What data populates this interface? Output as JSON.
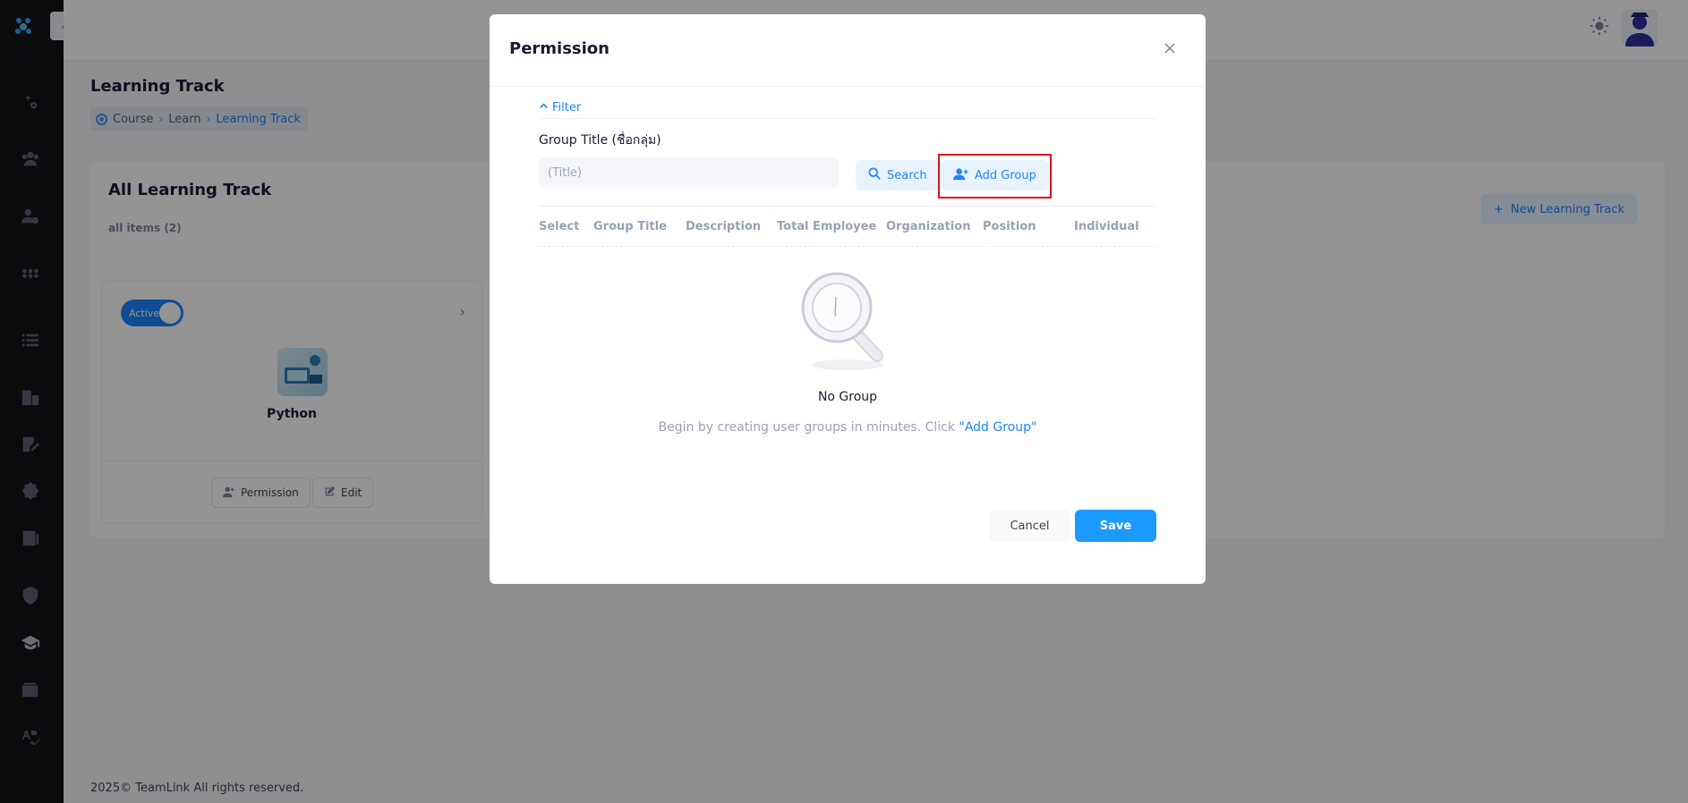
{
  "page": {
    "title": "Learning Track",
    "breadcrumb": [
      "Course",
      "Learn",
      "Learning Track"
    ]
  },
  "card": {
    "title": "All Learning Track",
    "subtitle": "all items (2)",
    "new_button": "New Learning Track"
  },
  "track": {
    "status": "Active",
    "name": "Python",
    "permission_button": "Permission",
    "edit_button": "Edit"
  },
  "footer": {
    "text": "2025© TeamLink All rights reserved."
  },
  "modal": {
    "title": "Permission",
    "filter_label": "Filter",
    "field_label": "Group Title (ชื่อกลุ่ม)",
    "title_placeholder": "(Title)",
    "search_button": "Search",
    "add_group_button": "Add Group",
    "columns": [
      "Select",
      "Group Title",
      "Description",
      "Total Employee",
      "Organization",
      "Position",
      "Individual"
    ],
    "empty_title": "No Group",
    "empty_desc": "Begin by creating user groups in minutes. Click ",
    "empty_link": "\"Add Group\"",
    "cancel_button": "Cancel",
    "save_button": "Save"
  },
  "colors": {
    "accent": "#1b84ff",
    "sidebar_bg": "#131318",
    "highlight": "#e0111a"
  }
}
